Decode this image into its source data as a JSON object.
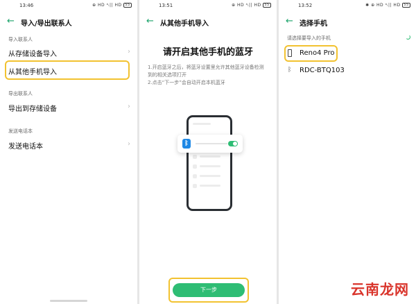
{
  "screen1": {
    "time": "13:46",
    "status_right": "⊕ HD ᵃᵢ|| HD",
    "battery": "55",
    "title": "导入/导出联系人",
    "sections": [
      {
        "header": "导入联系人",
        "items": [
          "从存储设备导入",
          "从其他手机导入"
        ]
      },
      {
        "header": "导出联系人",
        "items": [
          "导出到存储设备"
        ]
      },
      {
        "header": "发送电话本",
        "items": [
          "发送电话本"
        ]
      }
    ]
  },
  "screen2": {
    "time": "13:51",
    "status_right": "⊕ HD ᵃᵢ|| HD",
    "battery": "55",
    "title": "从其他手机导入",
    "headline": "请开启其他手机的蓝牙",
    "instructions": [
      "1.开启蓝牙之后，将蓝牙设置里允许其他蓝牙设备检测",
      "到的相关选项打开",
      "2.点击“下一步”会自动开启本机蓝牙"
    ],
    "next_button": "下一步"
  },
  "screen3": {
    "time": "13:52",
    "status_right": "✱ ⊕ HD ᵃᵢ|| HD",
    "battery": "55",
    "title": "选择手机",
    "hint": "请选择要导入的手机",
    "devices": [
      {
        "name": "Reno4 Pro",
        "icon": "phone-icon"
      },
      {
        "name": "RDC-BTQ103",
        "icon": "bluetooth-icon"
      }
    ]
  },
  "watermark": "云南龙网",
  "colors": {
    "accent": "#2ebd74",
    "highlight": "#f2c230",
    "bluetooth": "#1e88e5"
  }
}
